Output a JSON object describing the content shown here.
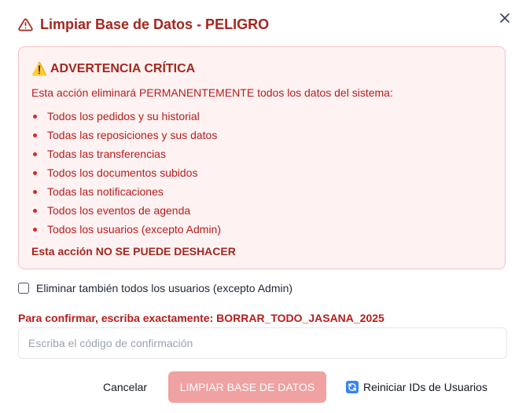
{
  "dialog": {
    "title": "Limpiar Base de Datos - PELIGRO",
    "close_icon": "close-icon",
    "title_icon": "warning-triangle-icon"
  },
  "warning": {
    "emoji": "⚠️",
    "heading": "ADVERTENCIA CRÍTICA",
    "intro": "Esta acción eliminará PERMANENTEMENTE todos los datos del sistema:",
    "items": [
      "Todos los pedidos y su historial",
      "Todas las reposiciones y sus datos",
      "Todas las transferencias",
      "Todos los documentos subidos",
      "Todas las notificaciones",
      "Todos los eventos de agenda",
      "Todos los usuarios (excepto Admin)"
    ],
    "final": "Esta acción NO SE PUEDE DESHACER"
  },
  "options": {
    "delete_users_label": "Eliminar también todos los usuarios (excepto Admin)",
    "delete_users_checked": false
  },
  "confirm": {
    "label": "Para confirmar, escriba exactamente: BORRAR_TODO_JASANA_2025",
    "placeholder": "Escriba el código de confirmación",
    "value": ""
  },
  "actions": {
    "cancel_label": "Cancelar",
    "clean_label": "LIMPIAR BASE DE DATOS",
    "reset_label": "Reiniciar IDs de Usuarios",
    "reset_icon": "refresh-icon"
  },
  "colors": {
    "danger": "#a3271f",
    "danger_light_bg": "#fef2f2",
    "disabled_button": "#f0a1a1"
  }
}
